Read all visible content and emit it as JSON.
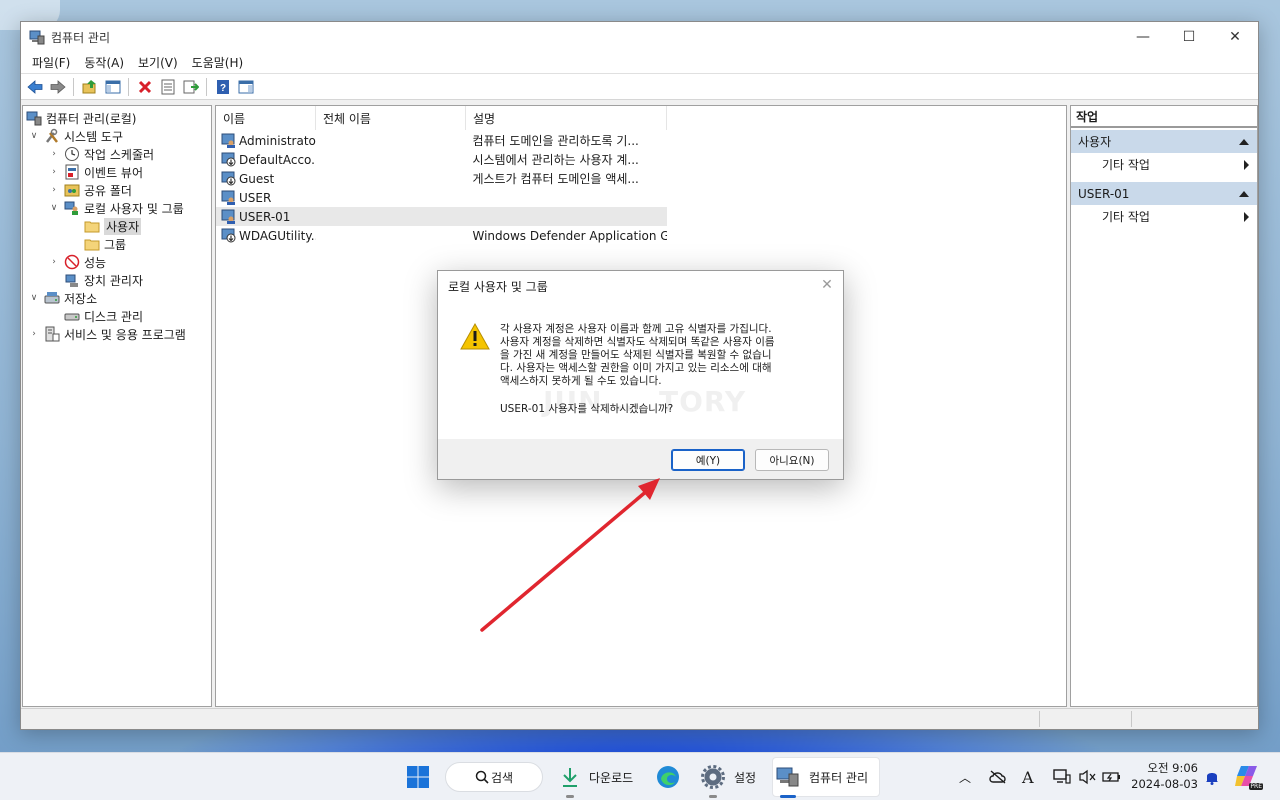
{
  "window": {
    "title": "컴퓨터 관리",
    "controls": {
      "minimize": "—",
      "maximize": "☐",
      "close": "✕"
    }
  },
  "menu": [
    "파일(F)",
    "동작(A)",
    "보기(V)",
    "도움말(H)"
  ],
  "toolbar": [
    "back-icon",
    "forward-icon",
    "up-folder-icon",
    "show-hide-console-tree-icon",
    "delete-icon",
    "properties-icon",
    "export-list-icon",
    "help-icon",
    "show-hide-action-pane-icon"
  ],
  "tree": {
    "root": "컴퓨터 관리(로컬)",
    "system_tools": "시스템 도구",
    "task_scheduler": "작업 스케줄러",
    "event_viewer": "이벤트 뷰어",
    "shared_folders": "공유 폴더",
    "local_users_groups": "로컬 사용자 및 그룹",
    "users": "사용자",
    "groups": "그룹",
    "performance": "성능",
    "device_manager": "장치 관리자",
    "storage": "저장소",
    "disk_management": "디스크 관리",
    "services_apps": "서비스 및 응용 프로그램"
  },
  "list": {
    "columns": [
      "이름",
      "전체 이름",
      "설명"
    ],
    "rows": [
      {
        "name": "Administrator",
        "full_name": "",
        "description": "컴퓨터 도메인을 관리하도록 기..."
      },
      {
        "name": "DefaultAcco...",
        "full_name": "",
        "description": "시스템에서 관리하는 사용자 계..."
      },
      {
        "name": "Guest",
        "full_name": "",
        "description": "게스트가 컴퓨터 도메인을 액세..."
      },
      {
        "name": "USER",
        "full_name": "",
        "description": ""
      },
      {
        "name": "USER-01",
        "full_name": "",
        "description": ""
      },
      {
        "name": "WDAGUtility...",
        "full_name": "",
        "description": "Windows Defender Application G..."
      }
    ]
  },
  "actions": {
    "title": "작업",
    "section1": "사용자",
    "section1_item": "기타 작업",
    "section2": "USER-01",
    "section2_item": "기타 작업"
  },
  "dialog": {
    "title": "로컬 사용자 및 그룹",
    "close": "✕",
    "message_lines": [
      "각 사용자 계정은 사용자 이름과 함께 고유 식별자를 가집니다.",
      "사용자 계정을 삭제하면 식별자도 삭제되며 똑같은 사용자 이름",
      "을 가진 새 계정을 만들어도 삭제된 식별자를 복원할 수 없습니",
      "다. 사용자는 액세스할 권한을 이미 가지고 있는 리소스에 대해",
      "액세스하지 못하게 될 수도 있습니다."
    ],
    "question": "USER-01 사용자를 삭제하시겠습니까?",
    "watermark": "JUN  ... TORY",
    "yes_button": "예(Y)",
    "no_button": "아니요(N)"
  },
  "taskbar": {
    "search": "검색",
    "downloads": "다운로드",
    "settings": "설정",
    "computer_management": "컴퓨터 관리",
    "time": "오전 9:06",
    "date": "2024-08-03",
    "copilot_badge": "PRE"
  },
  "colors": {
    "accent": "#1a62c8",
    "arrow": "#e0262f",
    "action_section": "#c9d9ea"
  }
}
